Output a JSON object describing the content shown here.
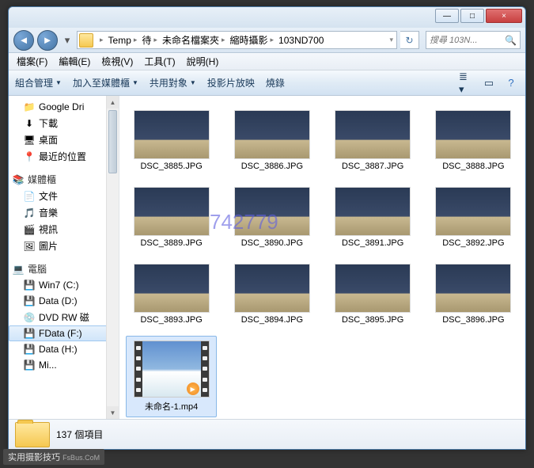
{
  "titlebar": {
    "min": "—",
    "max": "□",
    "close": "×"
  },
  "breadcrumbs": [
    "Temp",
    "待",
    "未命名檔案夾",
    "縮時攝影",
    "103ND700"
  ],
  "search": {
    "placeholder": "搜尋 103N..."
  },
  "menubar": [
    "檔案(F)",
    "編輯(E)",
    "檢視(V)",
    "工具(T)",
    "說明(H)"
  ],
  "toolbar": [
    "組合管理",
    "加入至媒體櫃",
    "共用對象",
    "投影片放映",
    "燒錄"
  ],
  "sidebar": {
    "quick": {
      "items": [
        "Google Dri",
        "下載",
        "桌面",
        "最近的位置"
      ]
    },
    "libraries": {
      "header": "媒體櫃",
      "items": [
        "文件",
        "音樂",
        "視訊",
        "圖片"
      ]
    },
    "computer": {
      "header": "電腦",
      "items": [
        "Win7 (C:)",
        "Data (D:)",
        "DVD RW 磁",
        "FData (F:)",
        "Data (H:)"
      ],
      "selected": 3,
      "more": "Mi..."
    }
  },
  "files": {
    "images": [
      "DSC_3885.JPG",
      "DSC_3886.JPG",
      "DSC_3887.JPG",
      "DSC_3888.JPG",
      "DSC_3889.JPG",
      "DSC_3890.JPG",
      "DSC_3891.JPG",
      "DSC_3892.JPG",
      "DSC_3893.JPG",
      "DSC_3894.JPG",
      "DSC_3895.JPG",
      "DSC_3896.JPG"
    ],
    "video": "未命名-1.mp4",
    "video_selected": true
  },
  "statusbar": {
    "count": "137 個項目"
  },
  "watermark": "742779",
  "footer": {
    "main": "实用摄影技巧",
    "sub": "FsBus.CoM"
  }
}
